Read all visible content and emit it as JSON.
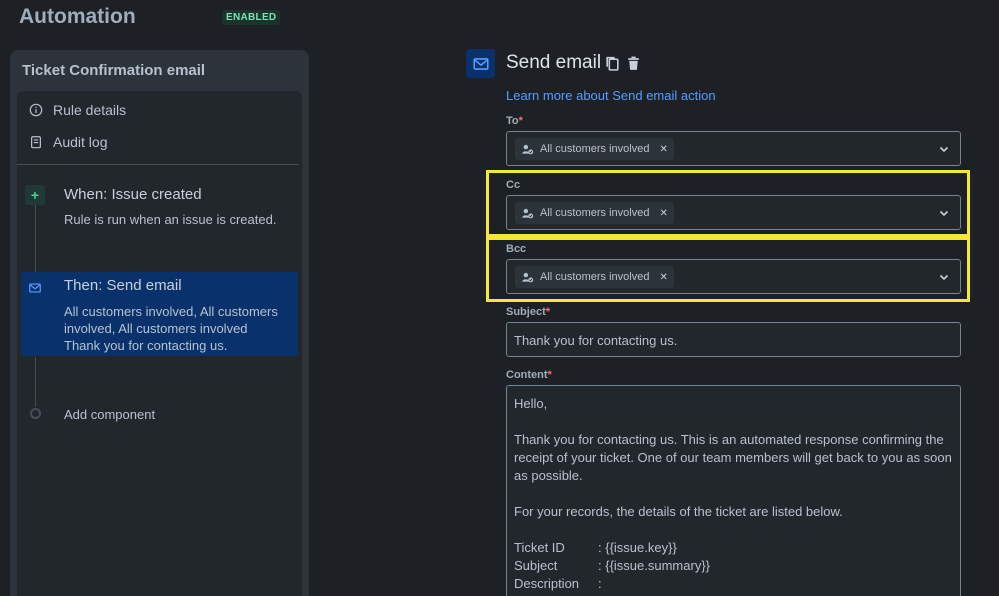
{
  "header": {
    "title": "Automation",
    "status_badge": "ENABLED"
  },
  "sidebar": {
    "title": "Ticket Confirmation email",
    "menu": [
      {
        "label": "Rule details",
        "icon": "info-icon"
      },
      {
        "label": "Audit log",
        "icon": "clipboard-icon"
      }
    ],
    "steps": {
      "trigger": {
        "title": "When: Issue created",
        "desc": "Rule is run when an issue is created."
      },
      "action": {
        "title": "Then: Send email",
        "desc_line1": "All customers involved, All customers",
        "desc_line2": "involved, All customers involved",
        "desc_line3": "Thank you for contacting us."
      },
      "add_component": "Add component"
    }
  },
  "main": {
    "title": "Send email",
    "learn_more": "Learn more about Send email action",
    "to": {
      "label": "To",
      "chip": "All customers involved"
    },
    "cc": {
      "label": "Cc",
      "chip": "All customers involved"
    },
    "bcc": {
      "label": "Bcc",
      "chip": "All customers involved"
    },
    "subject": {
      "label": "Subject",
      "value": "Thank you for contacting us."
    },
    "content": {
      "label": "Content",
      "greeting": "Hello,",
      "para1": "Thank you for contacting us. This is an automated response confirming the receipt of your ticket. One of our team members will get back to you as soon as possible.",
      "para2": "For your records, the details of the ticket are listed below.",
      "rows": [
        {
          "k": "Ticket ID",
          "v": ": {{issue.key}}"
        },
        {
          "k": "Subject",
          "v": ": {{issue.summary}}"
        },
        {
          "k": "Description",
          "v": ":"
        }
      ]
    }
  },
  "colors": {
    "highlight": "#f5e63a",
    "link": "#579dff",
    "selected": "#09326c",
    "enabled_green": "#7ee2b8"
  }
}
